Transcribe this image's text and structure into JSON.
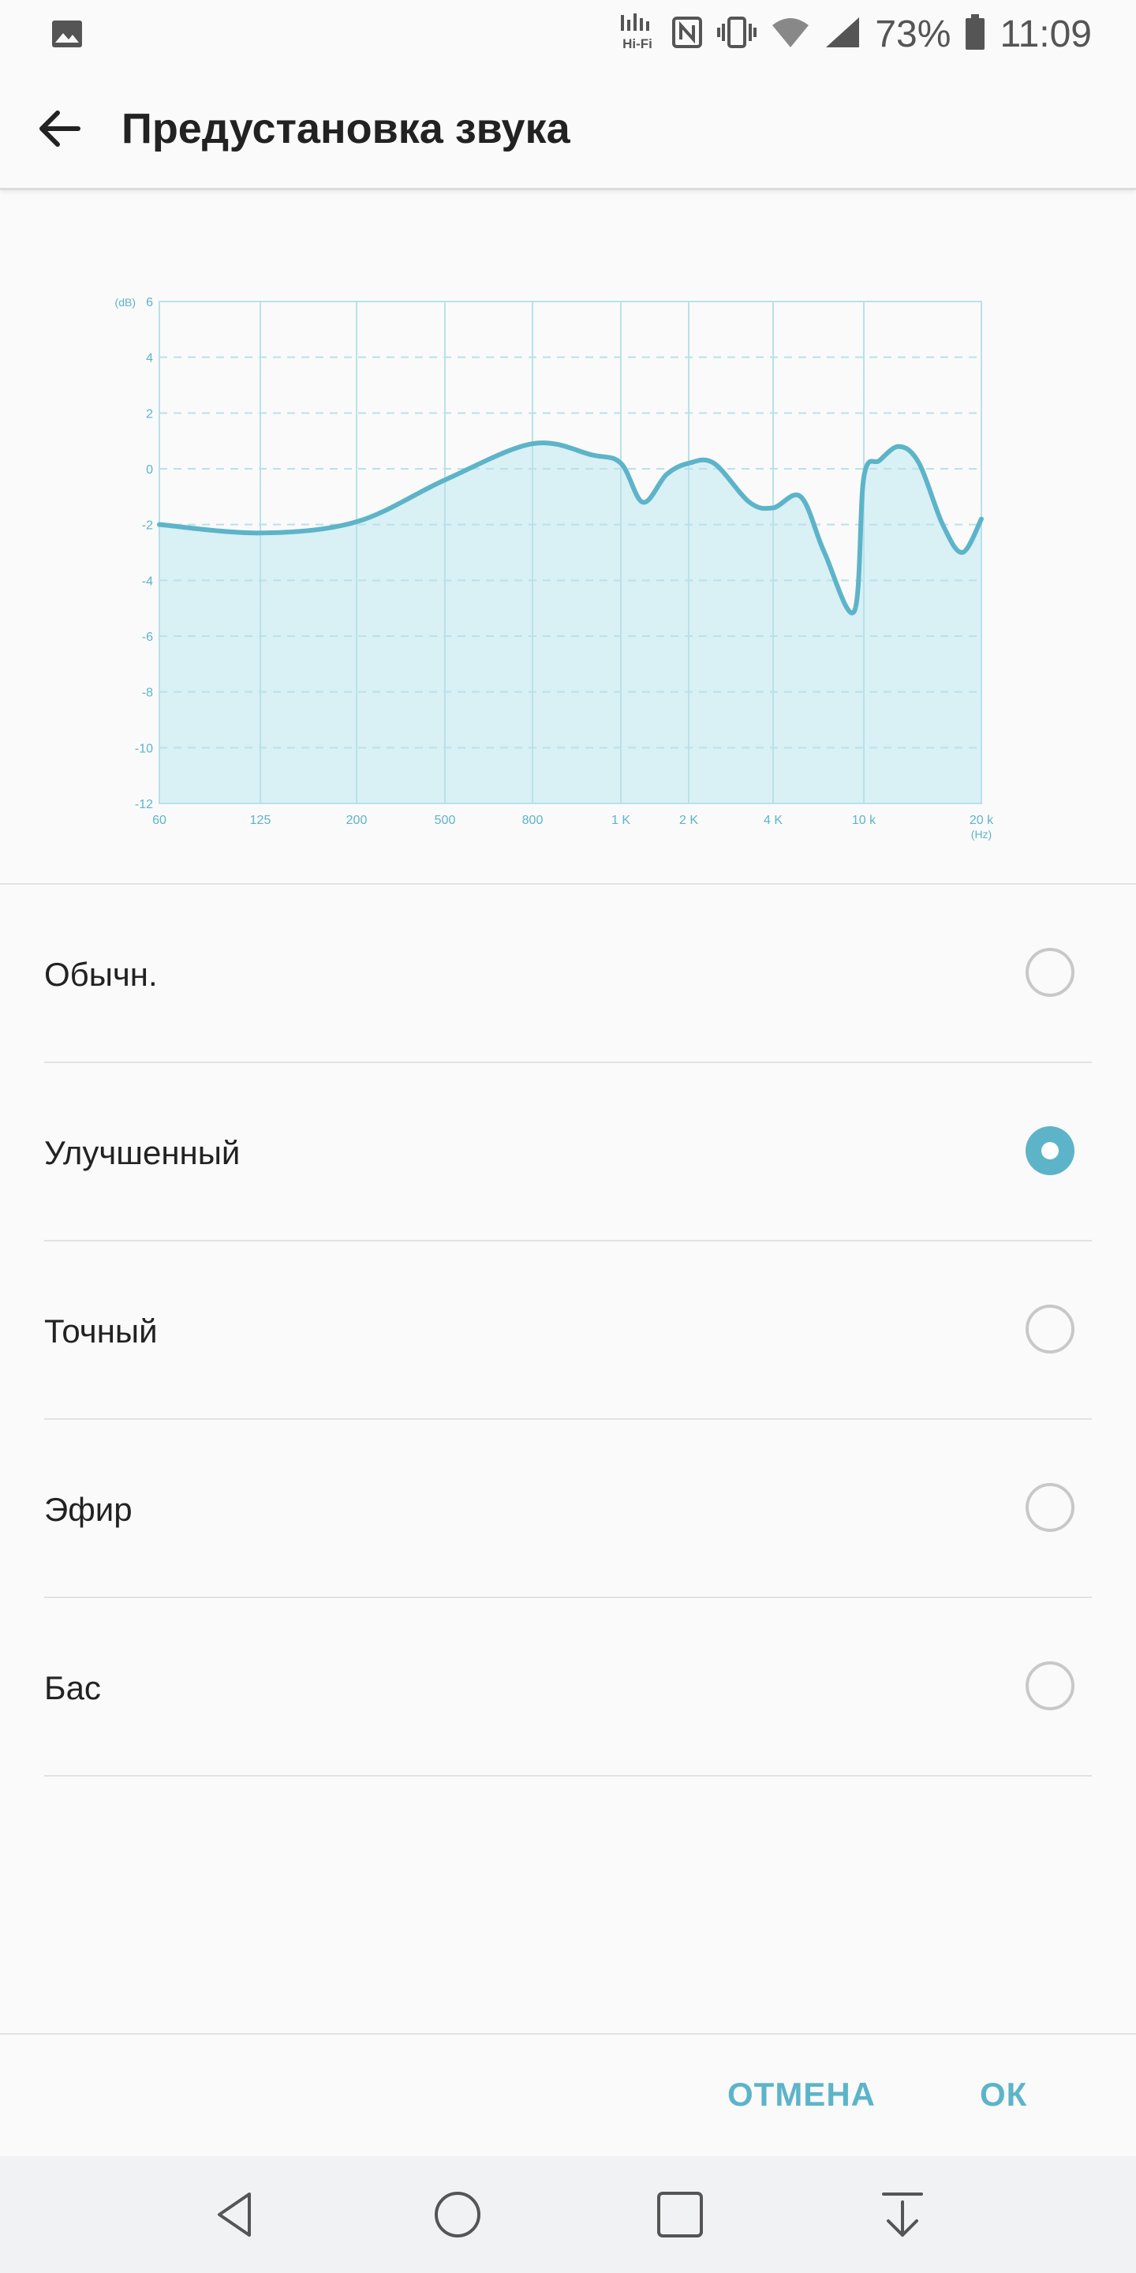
{
  "status_bar": {
    "hifi_label_top": "Hi",
    "hifi_label_bottom": "Hi-Fi",
    "battery": "73%",
    "time": "11:09",
    "icons": [
      "gallery-icon",
      "hifi-icon",
      "nfc-icon",
      "vibrate-icon",
      "wifi-icon",
      "signal-icon",
      "battery-icon"
    ]
  },
  "app_bar": {
    "title": "Предустановка звука",
    "back_icon": "arrow-left-icon"
  },
  "chart_data": {
    "type": "area",
    "ylabel": "(dB)",
    "xlabel": "(Hz)",
    "ylim": [
      -12,
      6
    ],
    "y_ticks": [
      6,
      4,
      2,
      0,
      -2,
      -4,
      -6,
      -8,
      -10,
      -12
    ],
    "x_ticks": [
      "60",
      "125",
      "200",
      "500",
      "800",
      "1 K",
      "2 K",
      "4 K",
      "10 k",
      "20 k"
    ],
    "grid": true,
    "line_color": "#5db4c9",
    "fill_color": "#d9f0f5",
    "series": [
      {
        "x": [
          "60",
          "125",
          "200",
          "500",
          "800",
          "1 K",
          "2 K",
          "4 K",
          "10 k",
          "20 k"
        ],
        "values": [
          -2.0,
          -2.3,
          -1.9,
          -0.4,
          0.9,
          0.2,
          0.2,
          -1.4,
          -0.3,
          -1.8
        ],
        "extra_points_note": ""
      }
    ]
  },
  "presets": {
    "items": [
      {
        "label": "Обычн.",
        "checked": false
      },
      {
        "label": "Улучшенный",
        "checked": true
      },
      {
        "label": "Точный",
        "checked": false
      },
      {
        "label": "Эфир",
        "checked": false
      },
      {
        "label": "Бас",
        "checked": false
      }
    ]
  },
  "dialog_buttons": {
    "cancel": "ОТМЕНА",
    "ok": "ОК"
  },
  "nav_bar": {
    "icons": [
      "back-triangle-icon",
      "home-circle-icon",
      "recents-square-icon",
      "notification-down-icon"
    ]
  },
  "colors": {
    "accent": "#5db4c9",
    "grid": "#b9e1ea"
  }
}
